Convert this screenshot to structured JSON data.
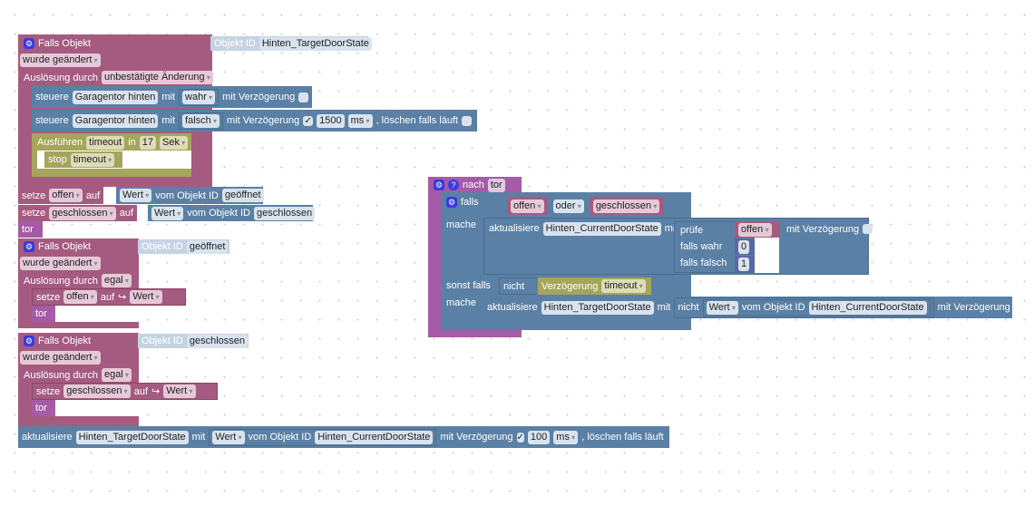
{
  "block1": {
    "title": "Falls Objekt",
    "objid_label": "Objekt ID",
    "objid": "Hinten_TargetDoorState",
    "trigger": "wurde geändert",
    "ausl_label": "Auslösung durch",
    "ausl": "unbestätigte Änderung",
    "s1": {
      "label": "steuere",
      "target": "Garagentor hinten",
      "mit": "mit",
      "value": "wahr",
      "delay_label": "mit Verzögerung"
    },
    "s2": {
      "label": "steuere",
      "target": "Garagentor hinten",
      "mit": "mit",
      "value": "falsch",
      "delay_label": "mit Verzögerung",
      "check": "✓",
      "delay": "1500",
      "unit": "ms",
      "clear_label": ", löschen falls läuft"
    },
    "timeout": {
      "label": "Ausführen",
      "name": "timeout",
      "in": "in",
      "value": "17",
      "unit": "Sek",
      "stop": "stop",
      "stop_name": "timeout"
    }
  },
  "set1": {
    "label": "setze",
    "var": "offen",
    "auf": "auf",
    "wert": "Wert",
    "vom": "vom Objekt ID",
    "obj": "geöffnet"
  },
  "set2": {
    "label": "setze",
    "var": "geschlossen",
    "auf": "auf",
    "wert": "Wert",
    "vom": "vom Objekt ID",
    "obj": "geschlossen"
  },
  "tor": "tor",
  "block2": {
    "title": "Falls Objekt",
    "objid_label": "Objekt ID",
    "objid": "geöffnet",
    "trigger": "wurde geändert",
    "ausl_label": "Auslösung durch",
    "ausl": "egal",
    "set": "setze",
    "var": "offen",
    "auf": "auf",
    "wert": "Wert",
    "tor": "tor"
  },
  "block3": {
    "title": "Falls Objekt",
    "objid_label": "Objekt ID",
    "objid": "geschlossen",
    "trigger": "wurde geändert",
    "ausl_label": "Auslösung durch",
    "ausl": "egal",
    "set": "setze",
    "var": "geschlossen",
    "auf": "auf",
    "wert": "Wert",
    "tor": "tor"
  },
  "update": {
    "label": "aktualisiere",
    "target": "Hinten_TargetDoorState",
    "mit": "mit",
    "wert": "Wert",
    "vom": "vom Objekt ID",
    "obj": "Hinten_CurrentDoorState",
    "delay_label": "mit Verzögerung",
    "check": "✓",
    "delay": "100",
    "unit": "ms",
    "clear_label": ", löschen falls läuft"
  },
  "proc": {
    "nach": "nach",
    "name": "tor",
    "falls": "falls",
    "a": "offen",
    "op": "oder",
    "b": "geschlossen",
    "mache": "mache",
    "u1": {
      "label": "aktualisiere",
      "target": "Hinten_CurrentDoorState",
      "mit": "mit",
      "pruefe": "prüfe",
      "cond": "offen",
      "wahr": "falls wahr",
      "v1": "0",
      "falsch": "falls falsch",
      "v2": "1",
      "delay_label": "mit Verzögerung"
    },
    "sonst": "sonst falls",
    "nicht": "nicht",
    "verz": "Verzögerung",
    "verz_name": "timeout",
    "mache2": "mache",
    "u2": {
      "label": "aktualisiere",
      "target": "Hinten_TargetDoorState",
      "mit": "mit",
      "nicht": "nicht",
      "wert": "Wert",
      "vom": "vom Objekt ID",
      "obj": "Hinten_CurrentDoorState",
      "delay_label": "mit Verzögerung"
    }
  }
}
